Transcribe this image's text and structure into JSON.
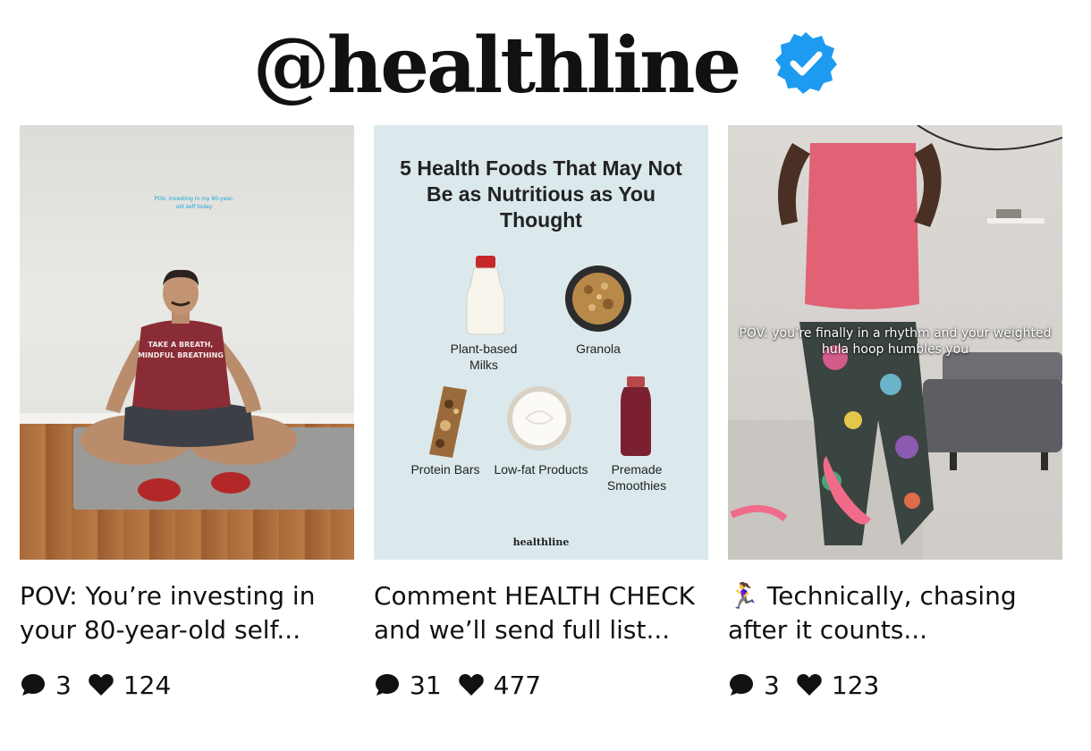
{
  "header": {
    "handle": "@healthline",
    "verified_icon": "verified-badge-icon",
    "badge_color": "#1d9bf0"
  },
  "posts": [
    {
      "thumbnail": {
        "overlay_text": "POV: investing in my 80-year-old self today",
        "shirt_text": "Take a breath, Mindful Breathing"
      },
      "caption": "POV: You’re investing in your 80-year-old self...",
      "comments": "3",
      "likes": "124",
      "comment_icon": "comment-icon",
      "like_icon": "heart-icon"
    },
    {
      "thumbnail": {
        "title": "5 Health Foods That May Not Be as Nutritious as You Thought",
        "items": [
          "Plant-based Milks",
          "Granola",
          "Protein Bars",
          "Low-fat Products",
          "Premade Smoothies"
        ],
        "brand": "healthline"
      },
      "caption": "Comment HEALTH CHECK and we’ll send full list...",
      "comments": "31",
      "likes": "477",
      "comment_icon": "comment-icon",
      "like_icon": "heart-icon"
    },
    {
      "thumbnail": {
        "overlay_text": "POV: you’re finally in a rhythm and your weighted hula hoop humbles you"
      },
      "caption": "🏃‍♀️ Technically, chasing after it counts...",
      "comments": "3",
      "likes": "123",
      "comment_icon": "comment-icon",
      "like_icon": "heart-icon"
    }
  ]
}
